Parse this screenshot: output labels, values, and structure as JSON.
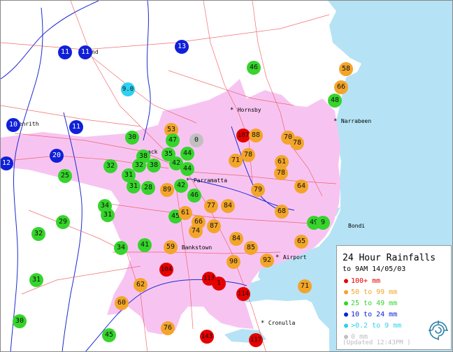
{
  "colors": {
    "sea": "#b5e3f5",
    "urban": "#f7c4f2",
    "red": "#e60000",
    "orange": "#f3a52a",
    "green": "#36d42c",
    "blue": "#1020d8",
    "cyan": "#2fd0f0",
    "grey": "#c0c0c0"
  },
  "places": [
    {
      "name": "Hornsby"
    },
    {
      "name": "Narrabeen"
    },
    {
      "name": "Penrith"
    },
    {
      "name": "Parramatta"
    },
    {
      "name": "Bankstown"
    },
    {
      "name": "Airport"
    },
    {
      "name": "Bondi"
    },
    {
      "name": "Cronulla"
    },
    {
      "name": "R"
    },
    {
      "name": "nd"
    },
    {
      "name": "ack"
    }
  ],
  "gauges": [
    {
      "value": "11",
      "category": "blue"
    },
    {
      "value": "11",
      "category": "blue"
    },
    {
      "value": "13",
      "category": "blue"
    },
    {
      "value": "46",
      "category": "green"
    },
    {
      "value": "58",
      "category": "orange"
    },
    {
      "value": "9.0",
      "category": "cyan"
    },
    {
      "value": "66",
      "category": "orange"
    },
    {
      "value": "48",
      "category": "green"
    },
    {
      "value": "10",
      "category": "blue"
    },
    {
      "value": "11",
      "category": "blue"
    },
    {
      "value": "30",
      "category": "green"
    },
    {
      "value": "53",
      "category": "orange"
    },
    {
      "value": "47",
      "category": "green"
    },
    {
      "value": "0",
      "category": "grey"
    },
    {
      "value": "107",
      "category": "red"
    },
    {
      "value": "88",
      "category": "orange"
    },
    {
      "value": "70",
      "category": "orange"
    },
    {
      "value": "78",
      "category": "orange"
    },
    {
      "value": "20",
      "category": "blue"
    },
    {
      "value": "38",
      "category": "green"
    },
    {
      "value": "35",
      "category": "green"
    },
    {
      "value": "44",
      "category": "green"
    },
    {
      "value": "78",
      "category": "orange"
    },
    {
      "value": "71",
      "category": "orange"
    },
    {
      "value": "61",
      "category": "orange"
    },
    {
      "value": "12",
      "category": "blue"
    },
    {
      "value": "32",
      "category": "green"
    },
    {
      "value": "32",
      "category": "green"
    },
    {
      "value": "38",
      "category": "green"
    },
    {
      "value": "42",
      "category": "green"
    },
    {
      "value": "44",
      "category": "green"
    },
    {
      "value": "78",
      "category": "orange"
    },
    {
      "value": "25",
      "category": "green"
    },
    {
      "value": "31",
      "category": "green"
    },
    {
      "value": "42",
      "category": "green"
    },
    {
      "value": "31",
      "category": "green"
    },
    {
      "value": "28",
      "category": "green"
    },
    {
      "value": "89",
      "category": "orange"
    },
    {
      "value": "46",
      "category": "green"
    },
    {
      "value": "79",
      "category": "orange"
    },
    {
      "value": "64",
      "category": "orange"
    },
    {
      "value": "34",
      "category": "green"
    },
    {
      "value": "31",
      "category": "green"
    },
    {
      "value": "77",
      "category": "orange"
    },
    {
      "value": "84",
      "category": "orange"
    },
    {
      "value": "68",
      "category": "orange"
    },
    {
      "value": "45",
      "category": "green"
    },
    {
      "value": "61",
      "category": "orange"
    },
    {
      "value": "29",
      "category": "green"
    },
    {
      "value": "66",
      "category": "orange"
    },
    {
      "value": "87",
      "category": "orange"
    },
    {
      "value": "74",
      "category": "orange"
    },
    {
      "value": "49",
      "category": "green"
    },
    {
      "value": "9",
      "category": "green"
    },
    {
      "value": "32",
      "category": "green"
    },
    {
      "value": "84",
      "category": "orange"
    },
    {
      "value": "65",
      "category": "orange"
    },
    {
      "value": "34",
      "category": "green"
    },
    {
      "value": "41",
      "category": "green"
    },
    {
      "value": "59",
      "category": "orange"
    },
    {
      "value": "85",
      "category": "orange"
    },
    {
      "value": "90",
      "category": "orange"
    },
    {
      "value": "92",
      "category": "orange"
    },
    {
      "value": "104",
      "category": "red"
    },
    {
      "value": "31",
      "category": "green"
    },
    {
      "value": "113",
      "category": "red"
    },
    {
      "value": "1",
      "category": "red"
    },
    {
      "value": "62",
      "category": "orange"
    },
    {
      "value": "114",
      "category": "red"
    },
    {
      "value": "71",
      "category": "orange"
    },
    {
      "value": "60",
      "category": "orange"
    },
    {
      "value": "30",
      "category": "green"
    },
    {
      "value": "76",
      "category": "orange"
    },
    {
      "value": "45",
      "category": "green"
    },
    {
      "value": "143",
      "category": "red"
    },
    {
      "value": "117",
      "category": "red"
    }
  ],
  "legend": {
    "title": "24 Hour Rainfalls",
    "subtitle": "to 9AM 14/05/03",
    "items": [
      {
        "label": "100+ mm",
        "color": "#e60000"
      },
      {
        "label": "50 to 99 mm",
        "color": "#f3a52a"
      },
      {
        "label": "25 to 49 mm",
        "color": "#36d42c"
      },
      {
        "label": "10 to 24 mm",
        "color": "#1020d8"
      },
      {
        "label": ">0.2 to 9 mm",
        "color": "#2fd0f0"
      },
      {
        "label": "0 mm",
        "color": "#c0c0c0"
      }
    ],
    "updated": "(Updated 12:43PM )",
    "logo_icon": "bom-swirl-icon"
  }
}
